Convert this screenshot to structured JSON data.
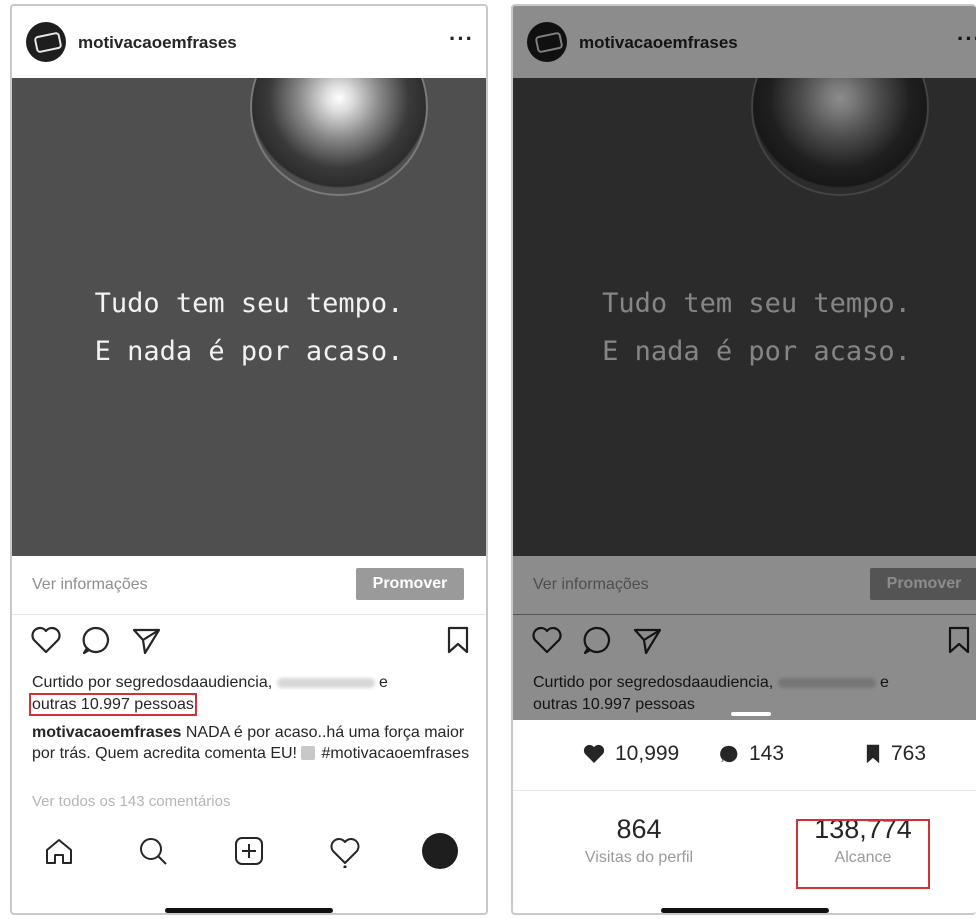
{
  "left_post": {
    "username": "motivacaoemfrases",
    "more_label": "···",
    "quote_line1": "Tudo tem seu tempo.",
    "quote_line2": "E nada é por acaso.",
    "ver_informacoes": "Ver informações",
    "promover": "Promover",
    "liked_by_prefix": "Curtido por ",
    "liked_by_user": "segredosdaaudiencia",
    "liked_by_sep": ", ",
    "liked_by_and": " e",
    "liked_by_others": "outras 10.997 pessoas",
    "caption_user": "motivacaoemfrases",
    "caption_text": " NADA é por acaso..há uma força maior por trás. Quem acredita comenta EU! ",
    "caption_hashtag": "#motivacaoemfrases",
    "view_comments": "Ver todos os 143 comentários"
  },
  "right_post": {
    "username": "motivacaoemfrases",
    "more_label": "···",
    "quote_line1": "Tudo tem seu tempo.",
    "quote_line2": "E nada é por acaso.",
    "ver_informacoes": "Ver informações",
    "promover": "Promover",
    "liked_by_prefix": "Curtido por ",
    "liked_by_user": "segredosdaaudiencia",
    "liked_by_sep": ", ",
    "liked_by_and": " e",
    "liked_by_others": "outras 10.997 pessoas"
  },
  "insights": {
    "likes": "10,999",
    "comments": "143",
    "saves": "763",
    "profile_visits_value": "864",
    "profile_visits_label": "Visitas do perfil",
    "reach_value": "138,774",
    "reach_label": "Alcance"
  },
  "icons": {
    "like": "heart-icon",
    "comment": "comment-bubble-icon",
    "share": "paper-plane-icon",
    "save": "bookmark-icon",
    "home": "home-icon",
    "search": "search-icon",
    "new_post": "plus-square-icon",
    "activity": "heart-icon",
    "profile": "avatar"
  },
  "colors": {
    "highlight_box": "#d0323a",
    "promote_button": "#9a9a9a",
    "photo_bg": "#4f4f4f"
  }
}
